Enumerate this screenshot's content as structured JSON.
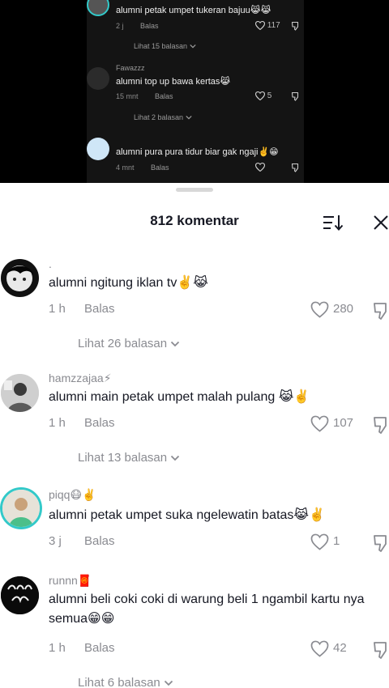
{
  "video": {
    "comments": [
      {
        "text": "alumni petak umpet tukeran bajuu😹😹",
        "time": "2 j",
        "reply": "Balas",
        "likes": "117"
      },
      {
        "user": "Fawazzz",
        "text": "alumni top up bawa kertas😹",
        "time": "15 mnt",
        "reply": "Balas",
        "likes": "5"
      },
      {
        "text": "alumni pura pura tidur biar gak ngaji✌️😁",
        "time": "4 mnt",
        "reply": "Balas",
        "likes": ""
      }
    ],
    "view_replies": [
      "Lihat 15 balasan",
      "Lihat 2 balasan"
    ]
  },
  "sheet": {
    "title": "812 komentar"
  },
  "comments": [
    {
      "user": ".",
      "text": "alumni ngitung iklan tv✌️😹",
      "time": "1 h",
      "reply": "Balas",
      "likes": "280",
      "view_replies": "Lihat 26 balasan"
    },
    {
      "user": "hamzzajaa⚡",
      "text": "alumni main petak umpet malah pulang 😹✌️",
      "time": "1 h",
      "reply": "Balas",
      "likes": "107",
      "view_replies": "Lihat 13 balasan"
    },
    {
      "user": "piqq😷✌️",
      "text": "alumni petak umpet suka ngelewatin batas😹✌️",
      "time": "3 j",
      "reply": "Balas",
      "likes": "1"
    },
    {
      "user": "runnn🧧",
      "text": "alumni beli coki coki di warung beli 1 ngambil kartu nya semua😁😁",
      "time": "1 h",
      "reply": "Balas",
      "likes": "42",
      "view_replies": "Lihat 6 balasan"
    }
  ],
  "colors": {
    "text": "#161823",
    "muted": "#8a8b91",
    "story_ring": "#33c9c9"
  },
  "icons": [
    "heart-icon",
    "dislike-icon",
    "sort-icon",
    "close-icon",
    "chevron-down-icon"
  ]
}
